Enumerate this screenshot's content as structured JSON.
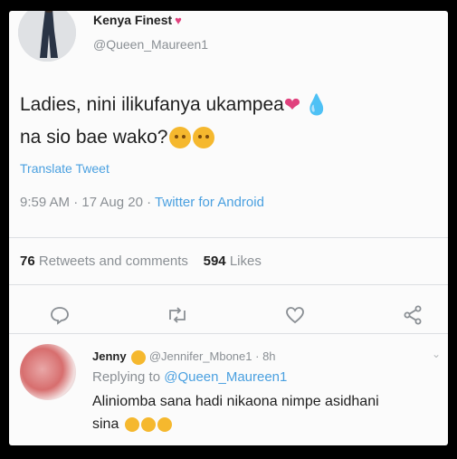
{
  "tweet": {
    "display_name": "Kenya Finest",
    "name_emoji": "heart-icon",
    "handle": "@Queen_Maureen1",
    "text_line1": "Ladies, nini ilikufanya ukampea",
    "text_line2": "na sio bae wako?",
    "translate": "Translate Tweet",
    "time": "9:59 AM",
    "date": "17 Aug 20",
    "source": "Twitter for Android",
    "retweets_count": "76",
    "retweets_label": "Retweets and comments",
    "likes_count": "594",
    "likes_label": "Likes"
  },
  "reply": {
    "display_name": "Jenny",
    "handle": "@Jennifer_Mbone1",
    "time": "8h",
    "replying_to_label": "Replying to",
    "replying_to_handle": "@Queen_Maureen1",
    "text_line1": "Aliniomba sana hadi nikaona nimpe asidhani",
    "text_line2": "sina"
  },
  "colors": {
    "link": "#4aa0e0",
    "muted": "#8a8f94",
    "text": "#1f1f1f",
    "emoji": "#f5b82e"
  }
}
